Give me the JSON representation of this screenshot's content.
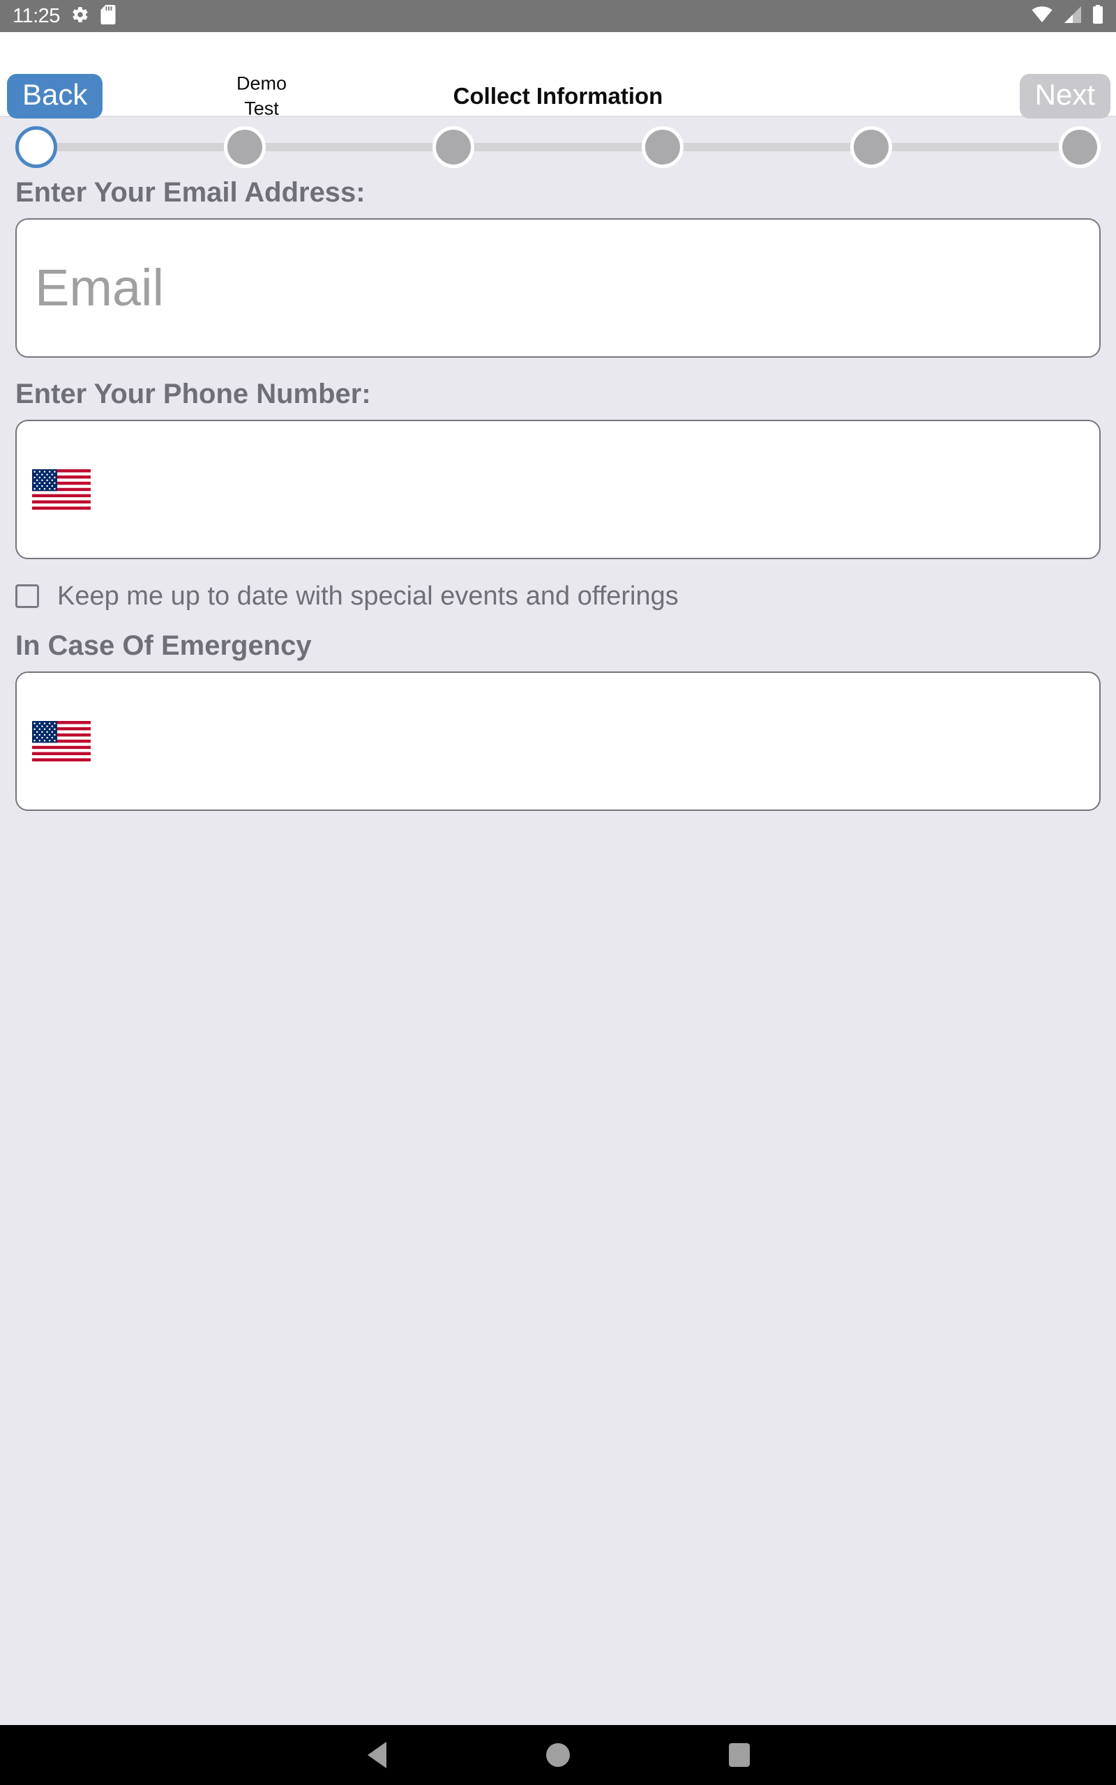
{
  "status_bar": {
    "time": "11:25",
    "left_icons": [
      "gear-icon",
      "sd-card-icon"
    ],
    "right_icons": [
      "wifi-icon",
      "cell-signal-icon",
      "battery-icon"
    ],
    "background": "#757575"
  },
  "header": {
    "back_label": "Back",
    "next_label": "Next",
    "next_disabled": true,
    "brand_line1": "Demo",
    "brand_line2": "Test",
    "title": "Collect Information",
    "back_color": "#4a86c5",
    "next_color": "#c9c9cd"
  },
  "stepper": {
    "total_steps": 6,
    "current_step": 1,
    "active_color": "#4a86c5",
    "inactive_color": "#aaaaac",
    "track_color": "#d4d4d6"
  },
  "form": {
    "email": {
      "label": "Enter Your Email Address:",
      "placeholder": "Email",
      "value": ""
    },
    "phone": {
      "label": "Enter Your Phone Number:",
      "country_flag": "us-flag-icon",
      "value": ""
    },
    "opt_in": {
      "label": "Keep me up to date with special events and offerings",
      "checked": false
    },
    "emergency": {
      "label": "In Case Of Emergency",
      "country_flag": "us-flag-icon",
      "value": ""
    }
  },
  "nav_bar": {
    "back_icon": "triangle-back-icon",
    "home_icon": "circle-home-icon",
    "recents_icon": "square-recents-icon",
    "background": "#000000"
  },
  "theme": {
    "page_background": "#e8e8ee",
    "label_color": "#6f6f77",
    "input_border": "#76767c"
  }
}
